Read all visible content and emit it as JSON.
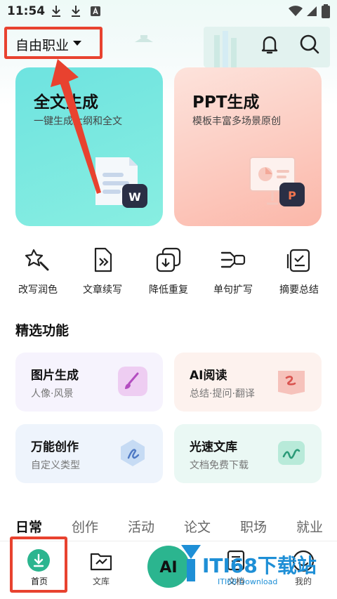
{
  "status_bar": {
    "time": "11:54"
  },
  "header": {
    "role": "自由职业"
  },
  "cards": [
    {
      "title": "全文生成",
      "subtitle": "一键生成大纲和全文",
      "badge": "W"
    },
    {
      "title": "PPT生成",
      "subtitle": "模板丰富多场景原创",
      "badge": "P"
    }
  ],
  "tools": [
    "改写润色",
    "文章续写",
    "降低重复",
    "单句扩写",
    "摘要总结"
  ],
  "featured": {
    "title": "精选功能",
    "items": [
      {
        "title": "图片生成",
        "subtitle": "人像·风景"
      },
      {
        "title": "AI阅读",
        "subtitle": "总结·提问·翻译"
      },
      {
        "title": "万能创作",
        "subtitle": "自定义类型"
      },
      {
        "title": "光速文库",
        "subtitle": "文档免费下载"
      }
    ]
  },
  "tabs": [
    "日常",
    "创作",
    "活动",
    "论文",
    "职场",
    "就业"
  ],
  "nav": [
    "首页",
    "文库",
    "AI",
    "文档",
    "我的"
  ],
  "watermark": {
    "brand": "ITI68下载站",
    "sub": "ITI68 Download"
  },
  "colors": {
    "annotation_red": "#e8422f",
    "accent_green": "#2bb58f"
  }
}
